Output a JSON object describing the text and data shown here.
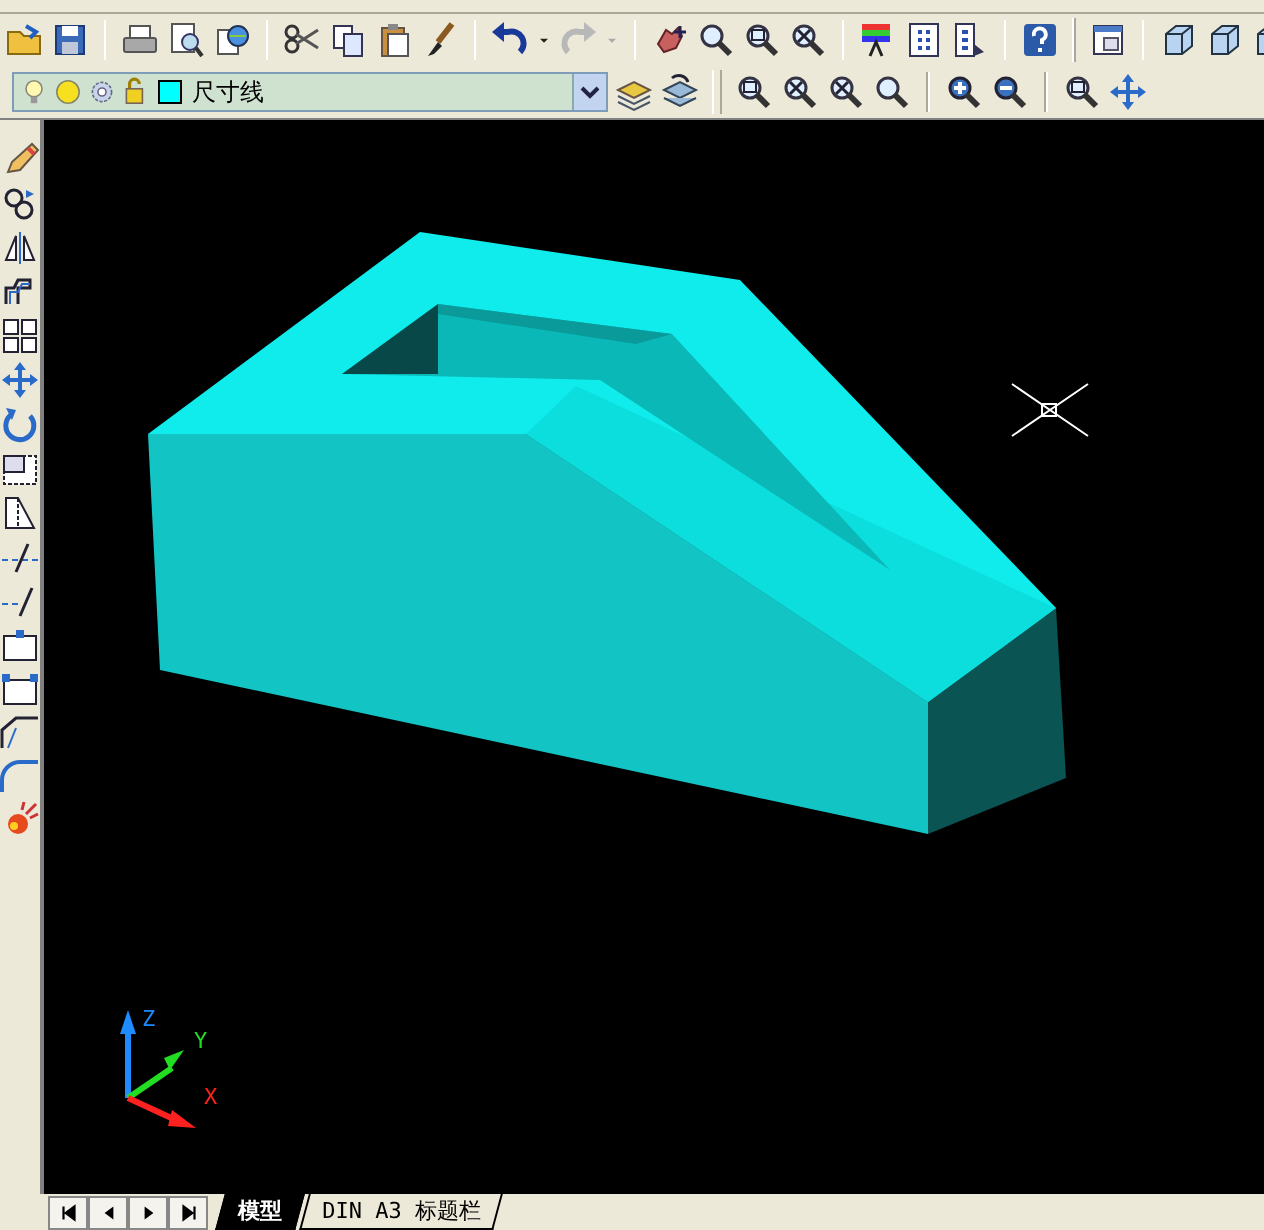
{
  "layer_toolbar": {
    "layer_name": "尺寸线",
    "layer_on": true
  },
  "ucs_icon": {
    "axes": [
      {
        "label": "Z",
        "color": "#1e8cff"
      },
      {
        "label": "Y",
        "color": "#22dd22"
      },
      {
        "label": "X",
        "color": "#ff2020"
      }
    ]
  },
  "layout_tabs": [
    {
      "label": "模型",
      "selected": true
    },
    {
      "label": "DIN A3 标题栏",
      "selected": false
    }
  ]
}
